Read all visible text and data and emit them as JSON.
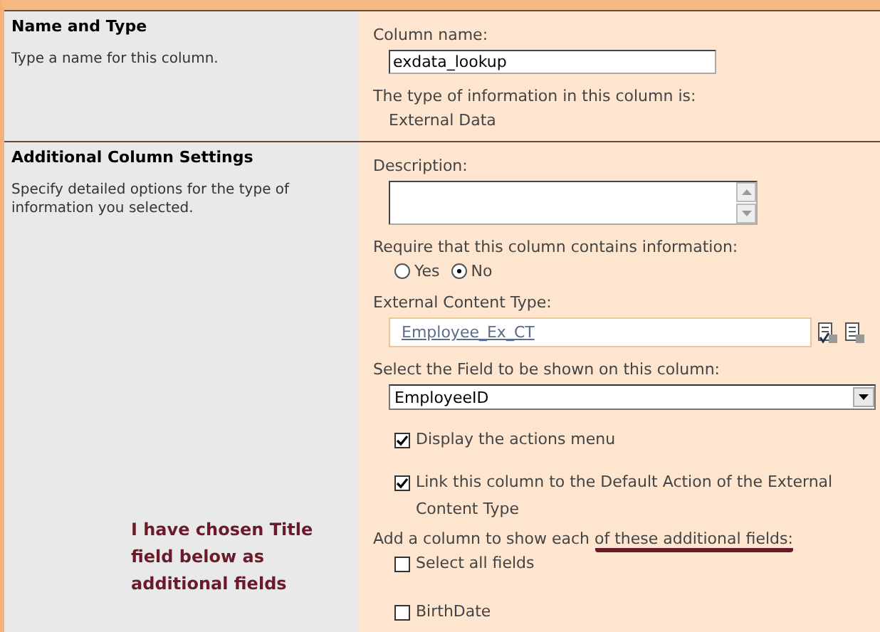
{
  "sections": [
    {
      "title": "Name and Type",
      "description": "Type a name for this column.",
      "fields": [
        {
          "kind": "text",
          "label": "Column name:",
          "value": "exdata_lookup"
        },
        {
          "kind": "info",
          "label": "The type of information in this column is:",
          "value": "External Data"
        }
      ]
    },
    {
      "title": "Additional Column Settings",
      "description": "Specify detailed options for the type of information you selected.",
      "note": "I have chosen Title field below as additional fields",
      "fields": [
        {
          "kind": "textarea",
          "label": "Description:"
        },
        {
          "kind": "radio",
          "label": "Require that this column contains information:",
          "options": [
            {
              "label": "Yes",
              "selected": false
            },
            {
              "label": "No",
              "selected": true
            }
          ]
        },
        {
          "kind": "picker",
          "label": "External Content Type:",
          "value": "Employee_Ex_CT"
        },
        {
          "kind": "select",
          "label": "Select the Field to be shown on this column:",
          "value": "EmployeeID"
        },
        {
          "kind": "check",
          "label": "Display the actions menu",
          "checked": true
        },
        {
          "kind": "check",
          "label": "Link this column to the Default Action of the External Content Type",
          "checked": true
        },
        {
          "kind": "fieldlist",
          "label": "Add a column to show each ",
          "highlight": "of these additional fields:",
          "items": [
            {
              "label": "Select all fields",
              "checked": false
            },
            {
              "label": "BirthDate",
              "checked": false
            }
          ]
        }
      ]
    }
  ]
}
